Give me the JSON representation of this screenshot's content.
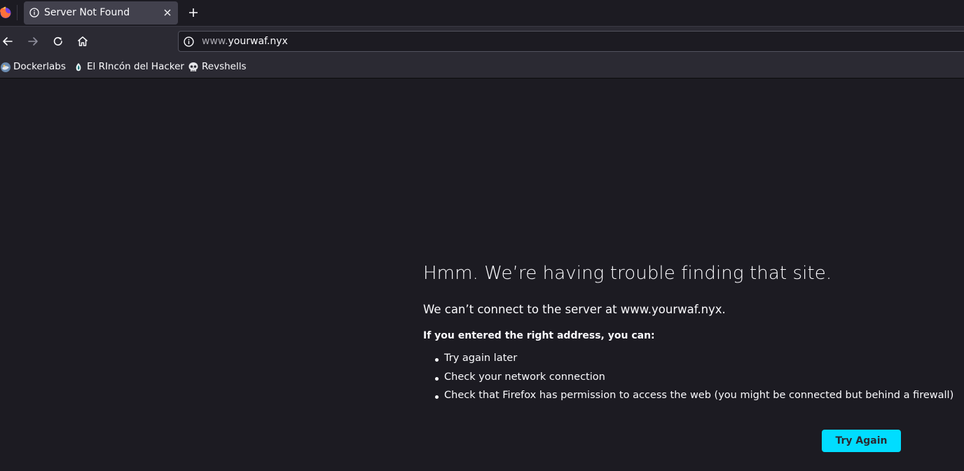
{
  "tab": {
    "title": "Server Not Found"
  },
  "urlbar": {
    "url_prefix": "www.",
    "url_host": "yourwaf.nyx"
  },
  "bookmarks": [
    {
      "label": "Dockerlabs",
      "icon": "dockerlabs-icon"
    },
    {
      "label": "El RIncón del Hacker",
      "icon": "hacker-icon"
    },
    {
      "label": "Revshells",
      "icon": "skull-icon"
    }
  ],
  "error": {
    "title": "Hmm. We’re having trouble finding that site.",
    "description": "We can’t connect to the server at www.yourwaf.nyx.",
    "suggestions_heading": "If you entered the right address, you can:",
    "suggestions": [
      "Try again later",
      "Check your network connection",
      "Check that Firefox has permission to access the web (you might be connected but behind a firewall)"
    ],
    "try_again_label": "Try Again"
  },
  "colors": {
    "page_bg": "#1c1b22",
    "toolbar_bg": "#2b2a33",
    "tab_active_bg": "#42414d",
    "accent": "#00ddff",
    "text": "#fbfbfe"
  }
}
